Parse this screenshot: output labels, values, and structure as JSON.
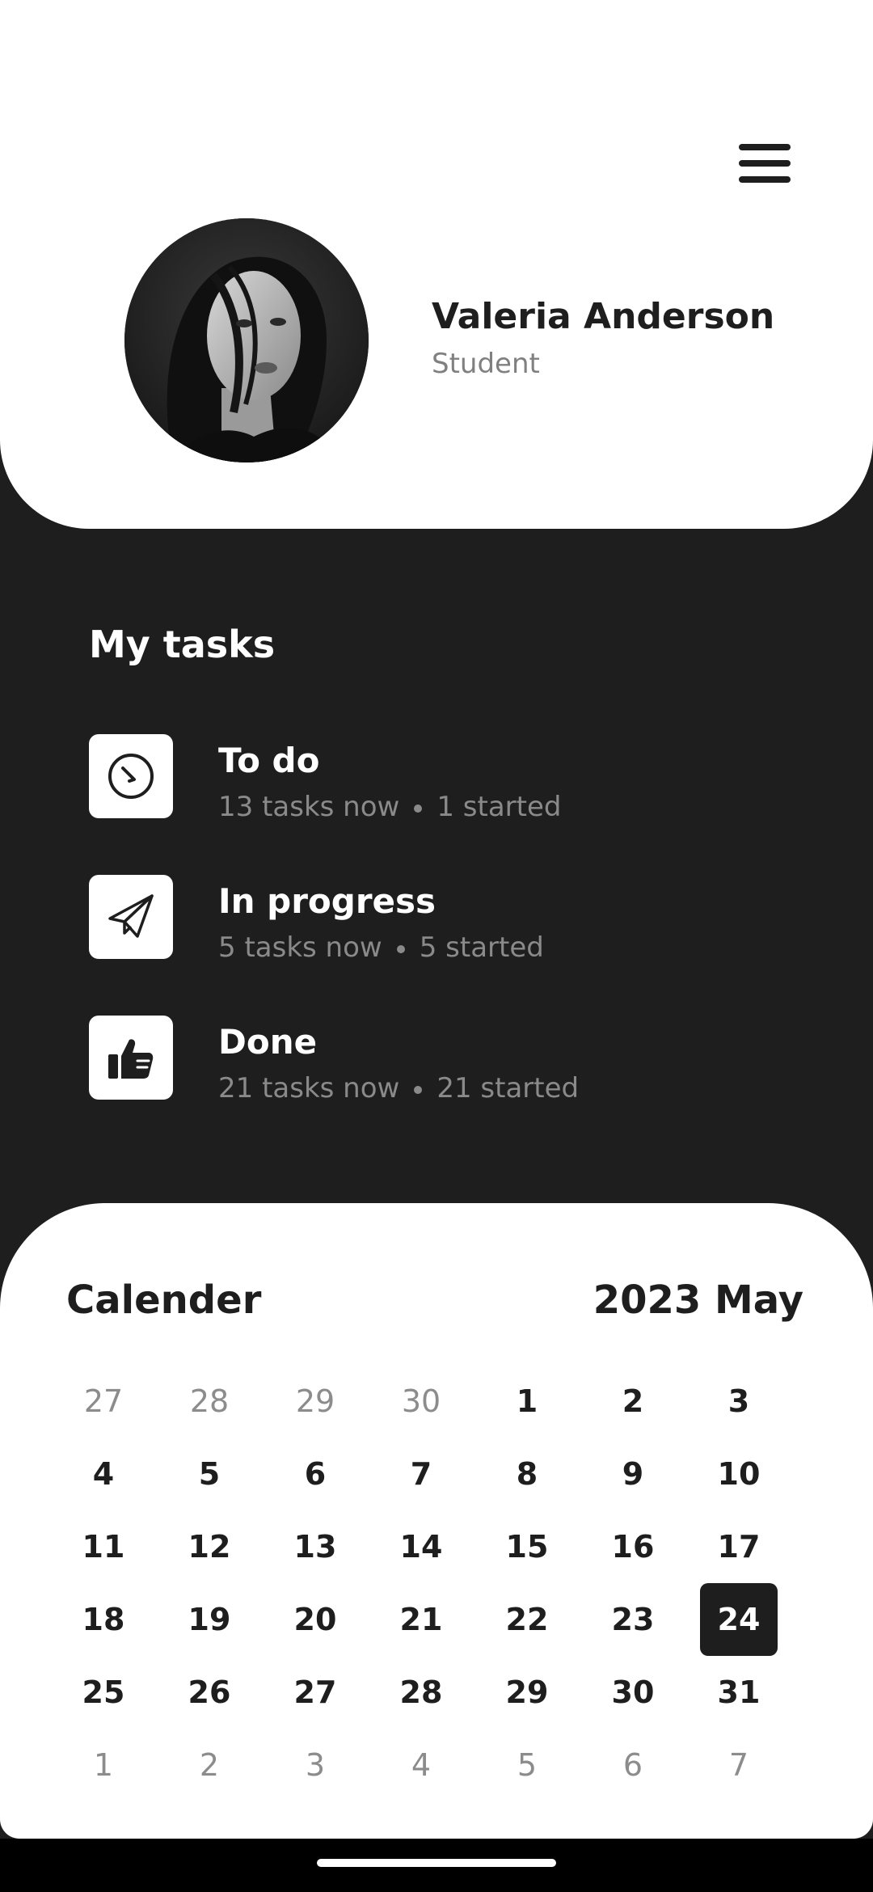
{
  "profile": {
    "name": "Valeria Anderson",
    "role": "Student",
    "avatar_icon": "user-photo-icon"
  },
  "menu": {
    "icon": "hamburger-menu-icon"
  },
  "tasks": {
    "title": "My tasks",
    "items": [
      {
        "label": "To do",
        "count_text": "13 tasks now",
        "started_text": "1 started",
        "icon": "clock-icon"
      },
      {
        "label": "In progress",
        "count_text": "5 tasks now",
        "started_text": "5 started",
        "icon": "paper-plane-icon"
      },
      {
        "label": "Done",
        "count_text": "21 tasks now",
        "started_text": "21 started",
        "icon": "thumbs-up-icon"
      }
    ]
  },
  "calendar": {
    "title": "Calender",
    "month_label": "2023 May",
    "selected_day": "24",
    "weeks": [
      [
        "27",
        "28",
        "29",
        "30",
        "1",
        "2",
        "3"
      ],
      [
        "4",
        "5",
        "6",
        "7",
        "8",
        "9",
        "10"
      ],
      [
        "11",
        "12",
        "13",
        "14",
        "15",
        "16",
        "17"
      ],
      [
        "18",
        "19",
        "20",
        "21",
        "22",
        "23",
        "24"
      ],
      [
        "25",
        "26",
        "27",
        "28",
        "29",
        "30",
        "31"
      ],
      [
        "1",
        "2",
        "3",
        "4",
        "5",
        "6",
        "7"
      ]
    ]
  },
  "colors": {
    "background": "#1e1e1e",
    "card": "#ffffff",
    "muted_text": "#8c8c8c"
  }
}
